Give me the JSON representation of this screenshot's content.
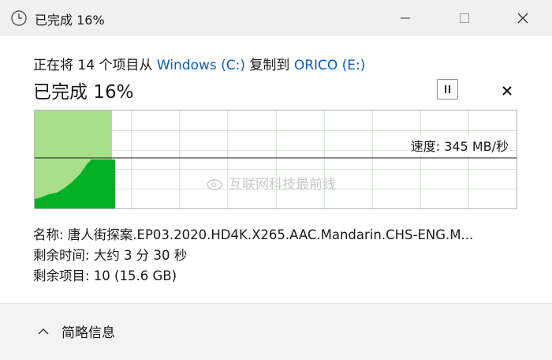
{
  "window": {
    "title": "已完成 16%",
    "clock_icon": "clock-icon",
    "controls": {
      "minimize_icon": "minimize-icon",
      "maximize_icon": "maximize-icon",
      "close_icon": "close-icon"
    }
  },
  "copy": {
    "prefix": "正在将 14 个项目从 ",
    "source": "Windows (C:)",
    "middle": " 复制到 ",
    "destination": "ORICO (E:)"
  },
  "progress": {
    "title": "已完成 16%",
    "percent": 16,
    "pause_icon": "pause-icon",
    "cancel_icon": "close-icon"
  },
  "graph": {
    "speed_text": "速度: 345 MB/秒",
    "fill_color": "#a8e08a",
    "speed_color": "#06b025"
  },
  "watermark": {
    "text": "互联网科技最前线"
  },
  "details": {
    "name": "名称: 唐人街探案.EP03.2020.HD4K.X265.AAC.Mandarin.CHS-ENG.M...",
    "time_remaining": "剩余时间: 大约 3 分 30 秒",
    "items_remaining": "剩余项目: 10 (15.6 GB)"
  },
  "footer": {
    "collapse_label": "简略信息",
    "chevron_icon": "chevron-up-icon"
  }
}
